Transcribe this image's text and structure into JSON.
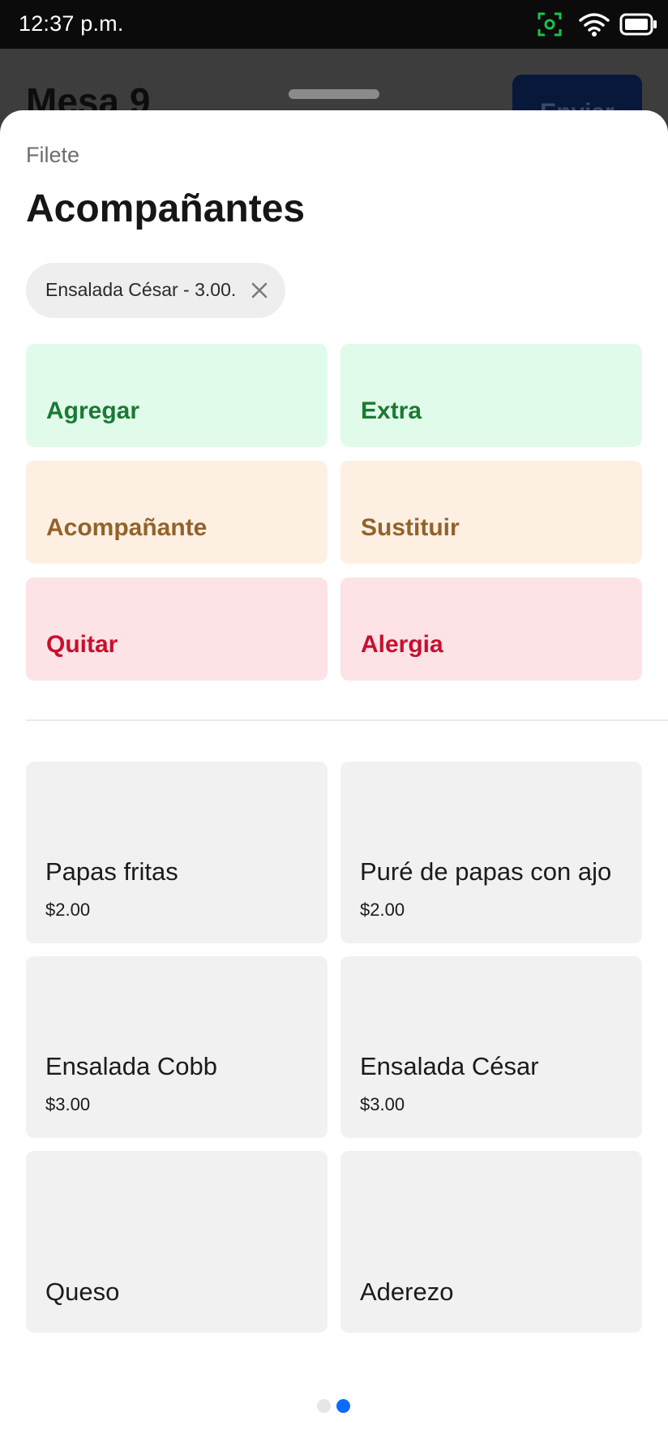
{
  "status_bar": {
    "time": "12:37 p.m."
  },
  "background": {
    "title": "Mesa 9",
    "send_label": "Enviar"
  },
  "sheet": {
    "subtitle": "Filete",
    "title": "Acompañantes",
    "selected_chip": {
      "label": "Ensalada César - 3.00."
    },
    "modifier_buttons": [
      {
        "label": "Agregar"
      },
      {
        "label": "Extra"
      },
      {
        "label": "Acompañante"
      },
      {
        "label": "Sustituir"
      },
      {
        "label": "Quitar"
      },
      {
        "label": "Alergia"
      }
    ],
    "items": [
      {
        "name": "Papas fritas",
        "price": "$2.00"
      },
      {
        "name": "Puré de papas con ajo",
        "price": "$2.00"
      },
      {
        "name": "Ensalada Cobb",
        "price": "$3.00"
      },
      {
        "name": "Ensalada César",
        "price": "$3.00"
      },
      {
        "name": "Queso"
      },
      {
        "name": "Aderezo"
      }
    ],
    "pager": {
      "pages": 2,
      "current": 2
    }
  },
  "colors": {
    "green_bg": "#e1fbea",
    "green_text": "#1a7a35",
    "orange_bg": "#fdf0e3",
    "orange_text": "#93622a",
    "red_bg": "#fde2e6",
    "red_text": "#c6102f",
    "accent": "#0a6cff"
  }
}
